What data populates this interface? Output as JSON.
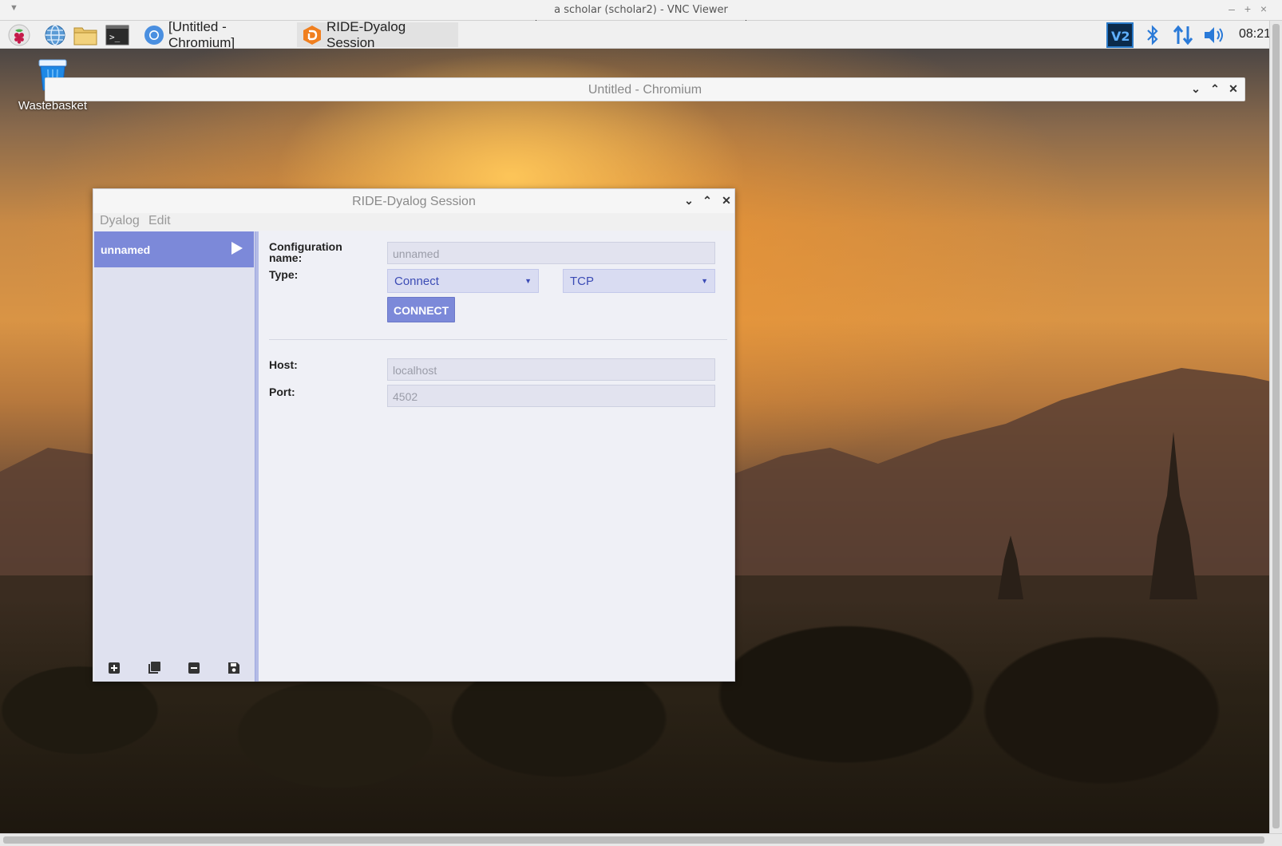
{
  "vnc": {
    "title": "a scholar (scholar2) - VNC Viewer",
    "minimize": "–",
    "maximize": "+",
    "close": "×",
    "menu_arrow": "▼"
  },
  "taskbar": {
    "tasks": [
      {
        "label": "[Untitled - Chromium]",
        "icon": "chromium-icon"
      },
      {
        "label": "RIDE-Dyalog Session",
        "icon": "ride-icon"
      }
    ],
    "clock": "08:21",
    "tray_icons": [
      "vnc-icon",
      "bluetooth-icon",
      "network-icon",
      "volume-icon"
    ]
  },
  "desktop": {
    "wastebasket_label": "Wastebasket"
  },
  "chromium_window": {
    "title": "Untitled - Chromium",
    "controls": {
      "minimize": "⌄",
      "maximize": "⌃",
      "close": "✕"
    }
  },
  "ride_window": {
    "title": "RIDE-Dyalog Session",
    "controls": {
      "minimize": "⌄",
      "maximize": "⌃",
      "close": "✕"
    },
    "menu": [
      "Dyalog",
      "Edit"
    ],
    "sidebar": {
      "items": [
        {
          "label": "unnamed",
          "selected": true
        }
      ],
      "tools": [
        "add-icon",
        "clone-icon",
        "remove-icon",
        "save-icon"
      ]
    },
    "form": {
      "config_name_label_line1": "Configuration",
      "config_name_label_line2": "name:",
      "config_name_value": "unnamed",
      "type_label": "Type:",
      "type_value": "Connect",
      "protocol_value": "TCP",
      "connect_button": "CONNECT",
      "host_label": "Host:",
      "host_value": "localhost",
      "port_label": "Port:",
      "port_value": "4502"
    },
    "colors": {
      "accent": "#7c89d9",
      "select_text": "#3b4bb5",
      "background": "#eff0f6"
    }
  }
}
